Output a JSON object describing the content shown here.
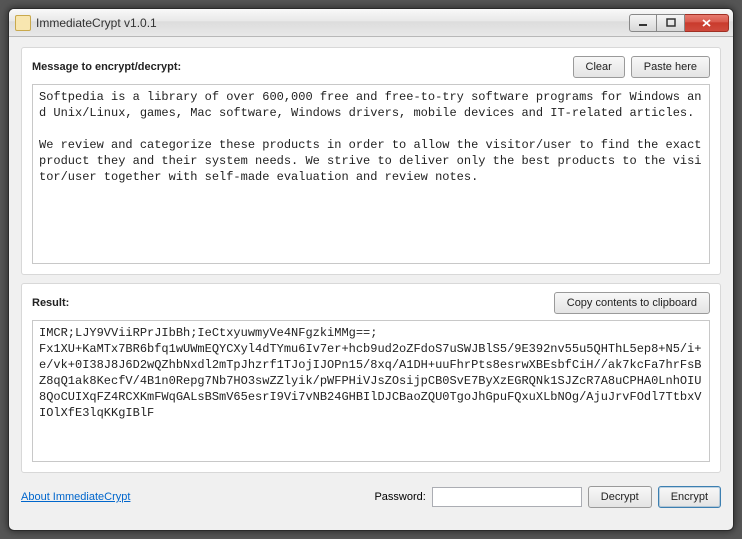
{
  "window": {
    "title": "ImmediateCrypt v1.0.1"
  },
  "section1": {
    "label": "Message to encrypt/decrypt:",
    "clear": "Clear",
    "paste": "Paste here",
    "content": "Softpedia is a library of over 600,000 free and free-to-try software programs for Windows and Unix/Linux, games, Mac software, Windows drivers, mobile devices and IT-related articles.\n\nWe review and categorize these products in order to allow the visitor/user to find the exact product they and their system needs. We strive to deliver only the best products to the visitor/user together with self-made evaluation and review notes."
  },
  "section2": {
    "label": "Result:",
    "copy": "Copy contents to clipboard",
    "content": "IMCR;LJY9VViiRPrJIbBh;IeCtxyuwmyVe4NFgzkiMMg==;\nFx1XU+KaMTx7BR6bfq1wUWmEQYCXyl4dTYmu6Iv7er+hcb9ud2oZFdoS7uSWJBlS5/9E392nv55u5QHThL5ep8+N5/i+e/vk+0I38J8J6D2wQZhbNxdl2mTpJhzrf1TJojIJOPn15/8xq/A1DH+uuFhrPts8esrwXBEsbfCiH//ak7kcFa7hrFsBZ8qQ1ak8KecfV/4B1n0Repg7Nb7HO3swZZlyik/pWFPHiVJsZOsijpCB0SvE7ByXzEGRQNk1SJZcR7A8uCPHA0LnhOIU8QoCUIXqFZ4RCXKmFWqGALsBSmV65esrI9Vi7vNB24GHBIlDJCBaoZQU0TgoJhGpuFQxuXLbNOg/AjuJrvFOdl7TtbxVIOlXfE3lqKKgIBlF"
  },
  "footer": {
    "about": "About ImmediateCrypt",
    "password_label": "Password:",
    "password_value": "",
    "decrypt": "Decrypt",
    "encrypt": "Encrypt"
  }
}
